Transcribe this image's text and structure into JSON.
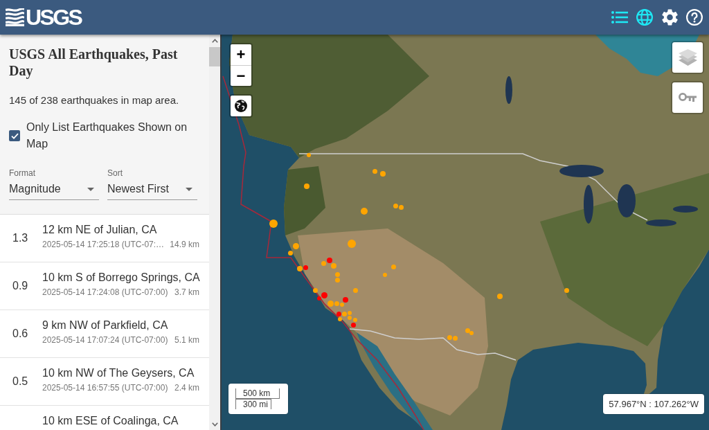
{
  "header": {
    "logo": "USGS",
    "view_buttons": [
      {
        "kind": "list",
        "selected": true
      },
      {
        "kind": "map",
        "selected": true
      },
      {
        "kind": "settings",
        "selected": false
      },
      {
        "kind": "help",
        "selected": false
      }
    ]
  },
  "list_panel": {
    "title": "USGS All Earthquakes, Past Day",
    "summary": "145 of 238 earthquakes in map area.",
    "only_list_shown": {
      "label": "Only List Earthquakes Shown on Map",
      "checked": true
    },
    "format": {
      "label": "Format",
      "value": "Magnitude"
    },
    "sort": {
      "label": "Sort",
      "value": "Newest First"
    },
    "earthquakes": [
      {
        "magnitude": "1.3",
        "place": "12 km NE of Julian, CA",
        "time": "2025-05-14 17:25:18 (UTC-07:…",
        "depth": "14.9 km"
      },
      {
        "magnitude": "0.9",
        "place": "10 km S of Borrego Springs, CA",
        "time": "2025-05-14 17:24:08 (UTC-07:00)",
        "depth": "3.7 km"
      },
      {
        "magnitude": "0.6",
        "place": "9 km NW of Parkfield, CA",
        "time": "2025-05-14 17:07:24 (UTC-07:00)",
        "depth": "5.1 km"
      },
      {
        "magnitude": "0.5",
        "place": "10 km NW of The Geysers, CA",
        "time": "2025-05-14 16:57:55 (UTC-07:00)",
        "depth": "2.4 km"
      },
      {
        "place": "10 km ESE of Coalinga, CA"
      }
    ]
  },
  "map": {
    "zoom_in": "+",
    "zoom_out": "−",
    "markers": [
      {
        "color": "#ffa500"
      },
      {
        "color": "#ffa500"
      },
      {
        "color": "#ffa500"
      },
      {
        "color": "#ffa500"
      },
      {
        "color": "#ffa500"
      },
      {
        "color": "#ffa500"
      },
      {
        "color": "#ffa500"
      },
      {
        "color": "#ffa500"
      },
      {
        "color": "#ffa500"
      },
      {
        "color": "#ffa500"
      },
      {
        "color": "#ffa500"
      },
      {
        "color": "#ffa500"
      },
      {
        "color": "#ff0000"
      },
      {
        "color": "#ffa500"
      },
      {
        "color": "#ffa500"
      },
      {
        "color": "#ff0000"
      },
      {
        "color": "#ffa500"
      },
      {
        "color": "#ffa500"
      },
      {
        "color": "#ffa500"
      },
      {
        "color": "#ffa500"
      },
      {
        "color": "#ffa500"
      },
      {
        "color": "#ffa500"
      },
      {
        "color": "#ff0000"
      },
      {
        "color": "#ff0000"
      },
      {
        "color": "#ff0000"
      },
      {
        "color": "#ffa500"
      },
      {
        "color": "#ffa500"
      },
      {
        "color": "#ffa500"
      },
      {
        "color": "#ffa500"
      },
      {
        "color": "#ff0000"
      },
      {
        "color": "#ffa500"
      },
      {
        "color": "#ffa500"
      },
      {
        "color": "#ffa500"
      },
      {
        "color": "#ffa500"
      },
      {
        "color": "#ff0000"
      },
      {
        "color": "#ffa500"
      },
      {
        "color": "#ffa500"
      },
      {
        "color": "#ffa500"
      },
      {
        "color": "#ffa500"
      },
      {
        "color": "#ffa500"
      },
      {
        "color": "#ffa500"
      }
    ],
    "scale": {
      "metric": "500 km",
      "imperial": "300 mi"
    },
    "coordinates": "57.967°N : 107.262°W"
  }
}
